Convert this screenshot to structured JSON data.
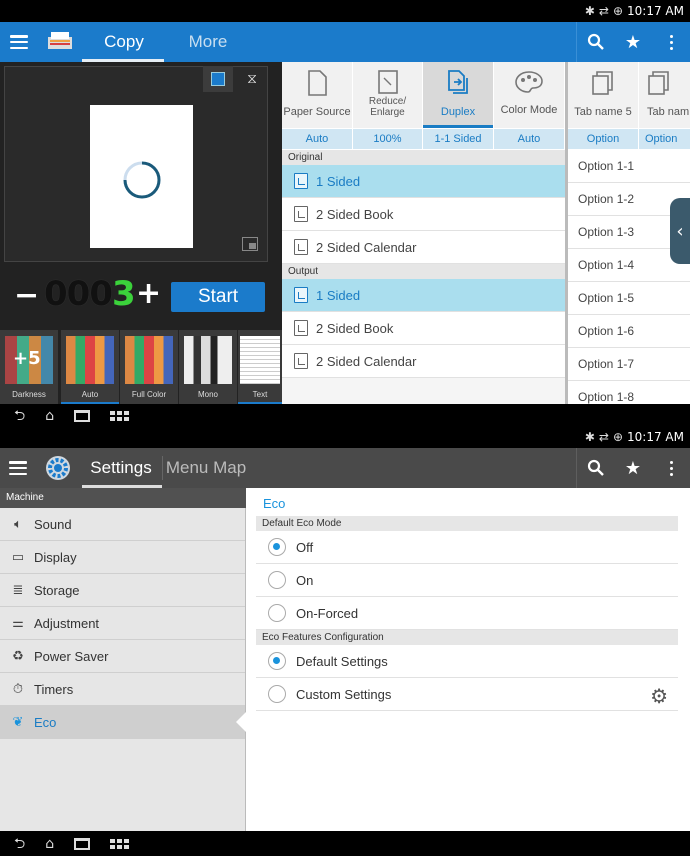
{
  "status": {
    "time": "10:17 AM"
  },
  "copy": {
    "tabs": [
      "Copy",
      "More"
    ],
    "counter": {
      "prefix": "000",
      "digit": "3",
      "minus": "−",
      "plus": "+"
    },
    "start_label": "Start",
    "option_tabs": [
      {
        "label": "Paper Source",
        "value": "Auto"
      },
      {
        "label": "Reduce/ Enlarge",
        "value": "100%"
      },
      {
        "label": "Duplex",
        "value": "1-1 Sided"
      },
      {
        "label": "Color Mode",
        "value": "Auto"
      },
      {
        "label": "Tab name 5",
        "value": "Option"
      },
      {
        "label": "Tab nam",
        "value": "Option"
      }
    ],
    "original_header": "Original",
    "output_header": "Output",
    "original_items": [
      "1 Sided",
      "2 Sided Book",
      "2 Sided Calendar"
    ],
    "output_items": [
      "1 Sided",
      "2 Sided Book",
      "2 Sided Calendar"
    ],
    "options_list": [
      "Option 1-1",
      "Option 1-2",
      "Option 1-3",
      "Option 1-4",
      "Option 1-5",
      "Option 1-6",
      "Option 1-7",
      "Option 1-8"
    ],
    "thumbnails": [
      {
        "label": "Darkness",
        "badge": "+5"
      },
      {
        "label": "Auto"
      },
      {
        "label": "Full Color"
      },
      {
        "label": "Mono"
      },
      {
        "label": "Text"
      }
    ]
  },
  "settings": {
    "tabs": [
      "Settings",
      "Menu Map"
    ],
    "sidebar_header": "Machine",
    "sidebar_items": [
      "Sound",
      "Display",
      "Storage",
      "Adjustment",
      "Power Saver",
      "Timers",
      "Eco"
    ],
    "section_title": "Eco",
    "default_eco_header": "Default Eco Mode",
    "eco_modes": [
      "Off",
      "On",
      "On-Forced"
    ],
    "eco_features_header": "Eco Features Configuration",
    "eco_features": [
      "Default Settings",
      "Custom Settings"
    ]
  },
  "colors": {
    "accent": "#1b7bcb",
    "selected_row": "#aadeee",
    "counter_green": "#3bd23b"
  }
}
